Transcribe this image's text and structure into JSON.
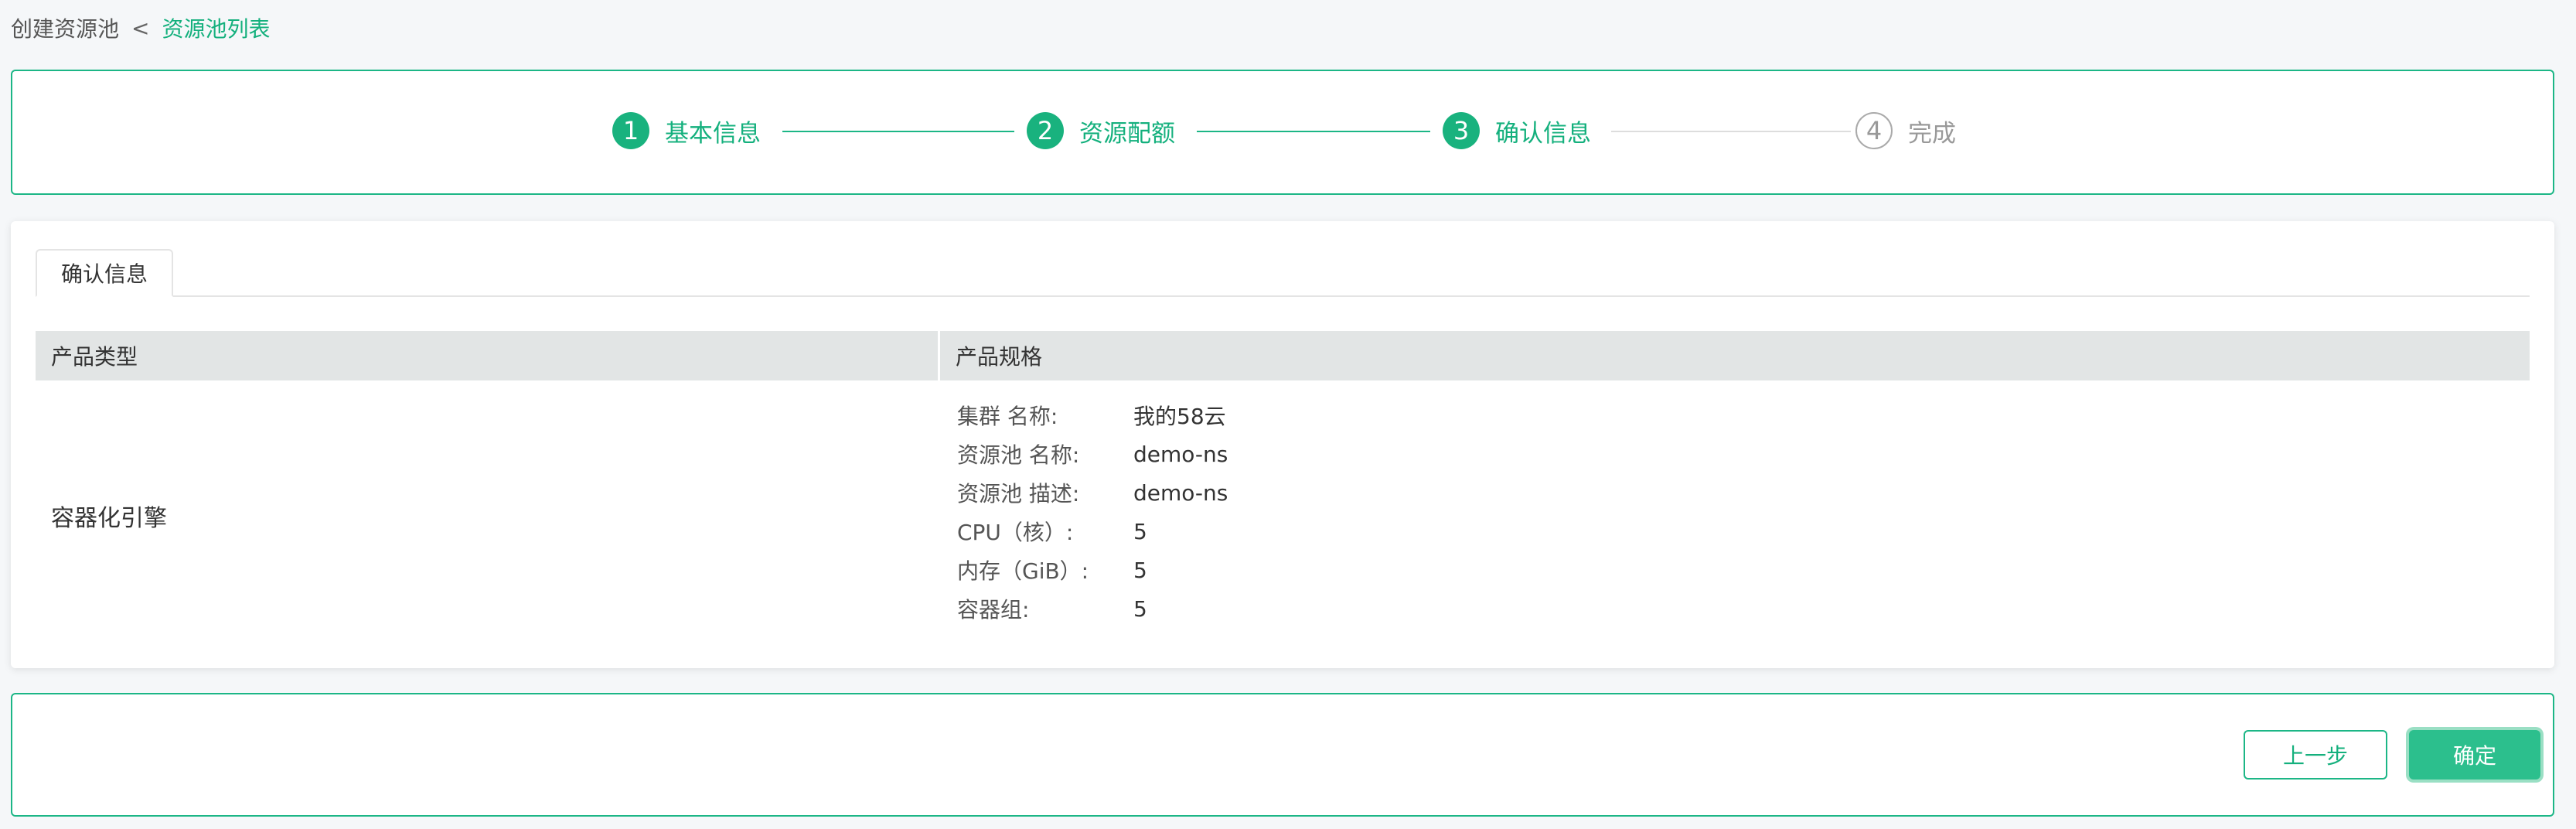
{
  "breadcrumb": {
    "current": "创建资源池",
    "separator": "<",
    "link": "资源池列表"
  },
  "steps": [
    {
      "number": "1",
      "label": "基本信息",
      "status": "done"
    },
    {
      "number": "2",
      "label": "资源配额",
      "status": "done"
    },
    {
      "number": "3",
      "label": "确认信息",
      "status": "active"
    },
    {
      "number": "4",
      "label": "完成",
      "status": "todo"
    }
  ],
  "tabs": {
    "active": "确认信息"
  },
  "table": {
    "headers": [
      "产品类型",
      "产品规格"
    ],
    "product_type": "容器化引擎",
    "specs": [
      {
        "label": "集群 名称:",
        "value": "我的58云"
      },
      {
        "label": "资源池 名称:",
        "value": "demo-ns"
      },
      {
        "label": "资源池 描述:",
        "value": "demo-ns"
      },
      {
        "label": "CPU（核）:",
        "value": "5"
      },
      {
        "label": "内存（GiB）:",
        "value": "5"
      },
      {
        "label": "容器组:",
        "value": "5"
      }
    ]
  },
  "footer": {
    "prev_label": "上一步",
    "confirm_label": "确定"
  },
  "colors": {
    "accent": "#1cb686",
    "accent_text": "#14b07d",
    "header_bg": "#e2e5e5",
    "page_bg": "#f5f7f9"
  }
}
